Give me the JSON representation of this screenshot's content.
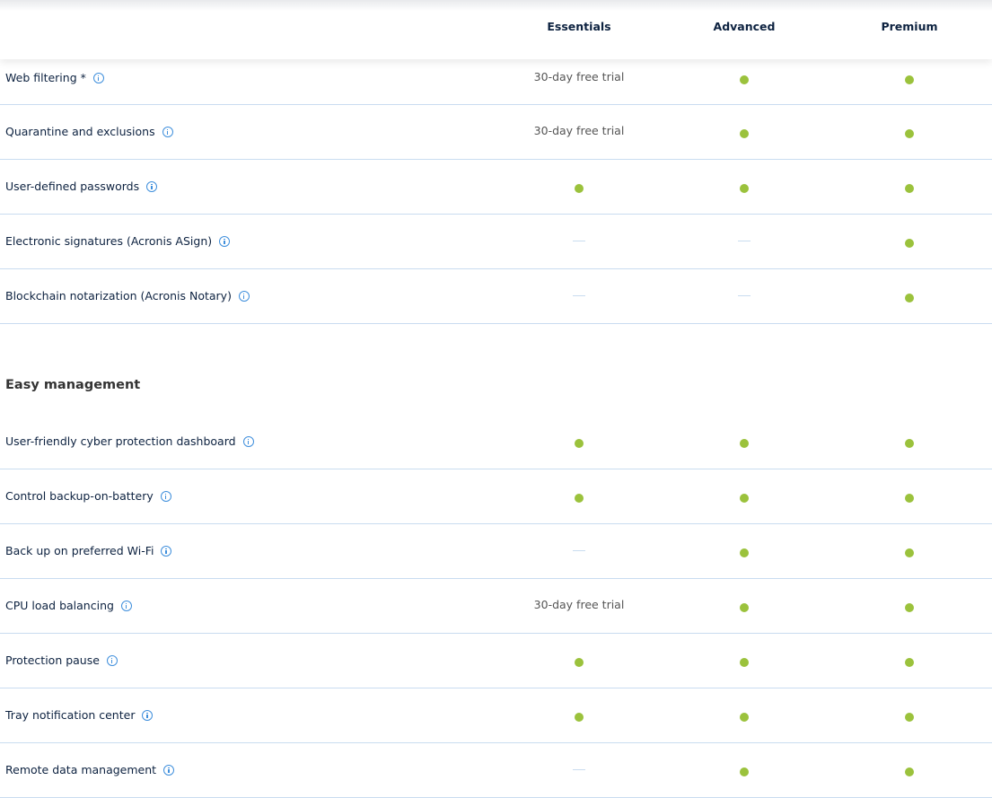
{
  "columns": [
    "Essentials",
    "Advanced",
    "Premium"
  ],
  "colors": {
    "included": "#9bc23c",
    "not_included": "#c9dcf0",
    "info": "#3f8fdc"
  },
  "groups": [
    {
      "title": "",
      "rows": [
        {
          "label": "Web filtering *",
          "values": [
            "30-day free trial",
            "yes",
            "yes"
          ]
        },
        {
          "label": "Quarantine and exclusions",
          "values": [
            "30-day free trial",
            "yes",
            "yes"
          ]
        },
        {
          "label": "User-defined passwords",
          "values": [
            "yes",
            "yes",
            "yes"
          ]
        },
        {
          "label": "Electronic signatures (Acronis ASign)",
          "values": [
            "no",
            "no",
            "yes"
          ]
        },
        {
          "label": "Blockchain notarization (Acronis Notary)",
          "values": [
            "no",
            "no",
            "yes"
          ]
        }
      ]
    },
    {
      "title": "Easy management",
      "rows": [
        {
          "label": "User-friendly cyber protection dashboard",
          "values": [
            "yes",
            "yes",
            "yes"
          ]
        },
        {
          "label": "Control backup-on-battery",
          "values": [
            "yes",
            "yes",
            "yes"
          ]
        },
        {
          "label": "Back up on preferred Wi-Fi",
          "values": [
            "no",
            "yes",
            "yes"
          ]
        },
        {
          "label": "CPU load balancing",
          "values": [
            "30-day free trial",
            "yes",
            "yes"
          ]
        },
        {
          "label": "Protection pause",
          "values": [
            "yes",
            "yes",
            "yes"
          ]
        },
        {
          "label": "Tray notification center",
          "values": [
            "yes",
            "yes",
            "yes"
          ]
        },
        {
          "label": "Remote data management",
          "values": [
            "no",
            "yes",
            "yes"
          ]
        }
      ]
    }
  ]
}
